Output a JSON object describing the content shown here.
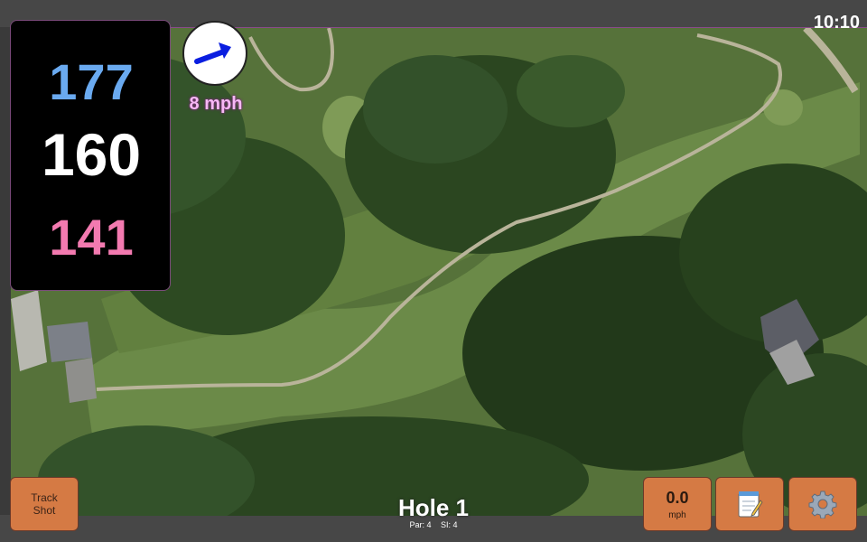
{
  "status_bar": {
    "time": "10:10"
  },
  "distances": {
    "back": "177",
    "middle": "160",
    "front": "141"
  },
  "wind": {
    "speed": "8 mph",
    "icon": "wind-direction-arrow-icon"
  },
  "buttons": {
    "track_shot_label": "Track Shot",
    "speed_value": "0.0",
    "speed_unit": "mph",
    "notes_icon": "notepad-icon",
    "settings_icon": "gear-icon"
  },
  "hole": {
    "title": "Hole 1",
    "par": "Par: 4",
    "stroke_index": "SI: 4"
  },
  "colors": {
    "back_distance": "#6aaaf0",
    "middle_distance": "#ffffff",
    "front_distance": "#f37ab0",
    "button_accent": "#d57a44",
    "wind_speed_text": "#f6b8f4"
  }
}
